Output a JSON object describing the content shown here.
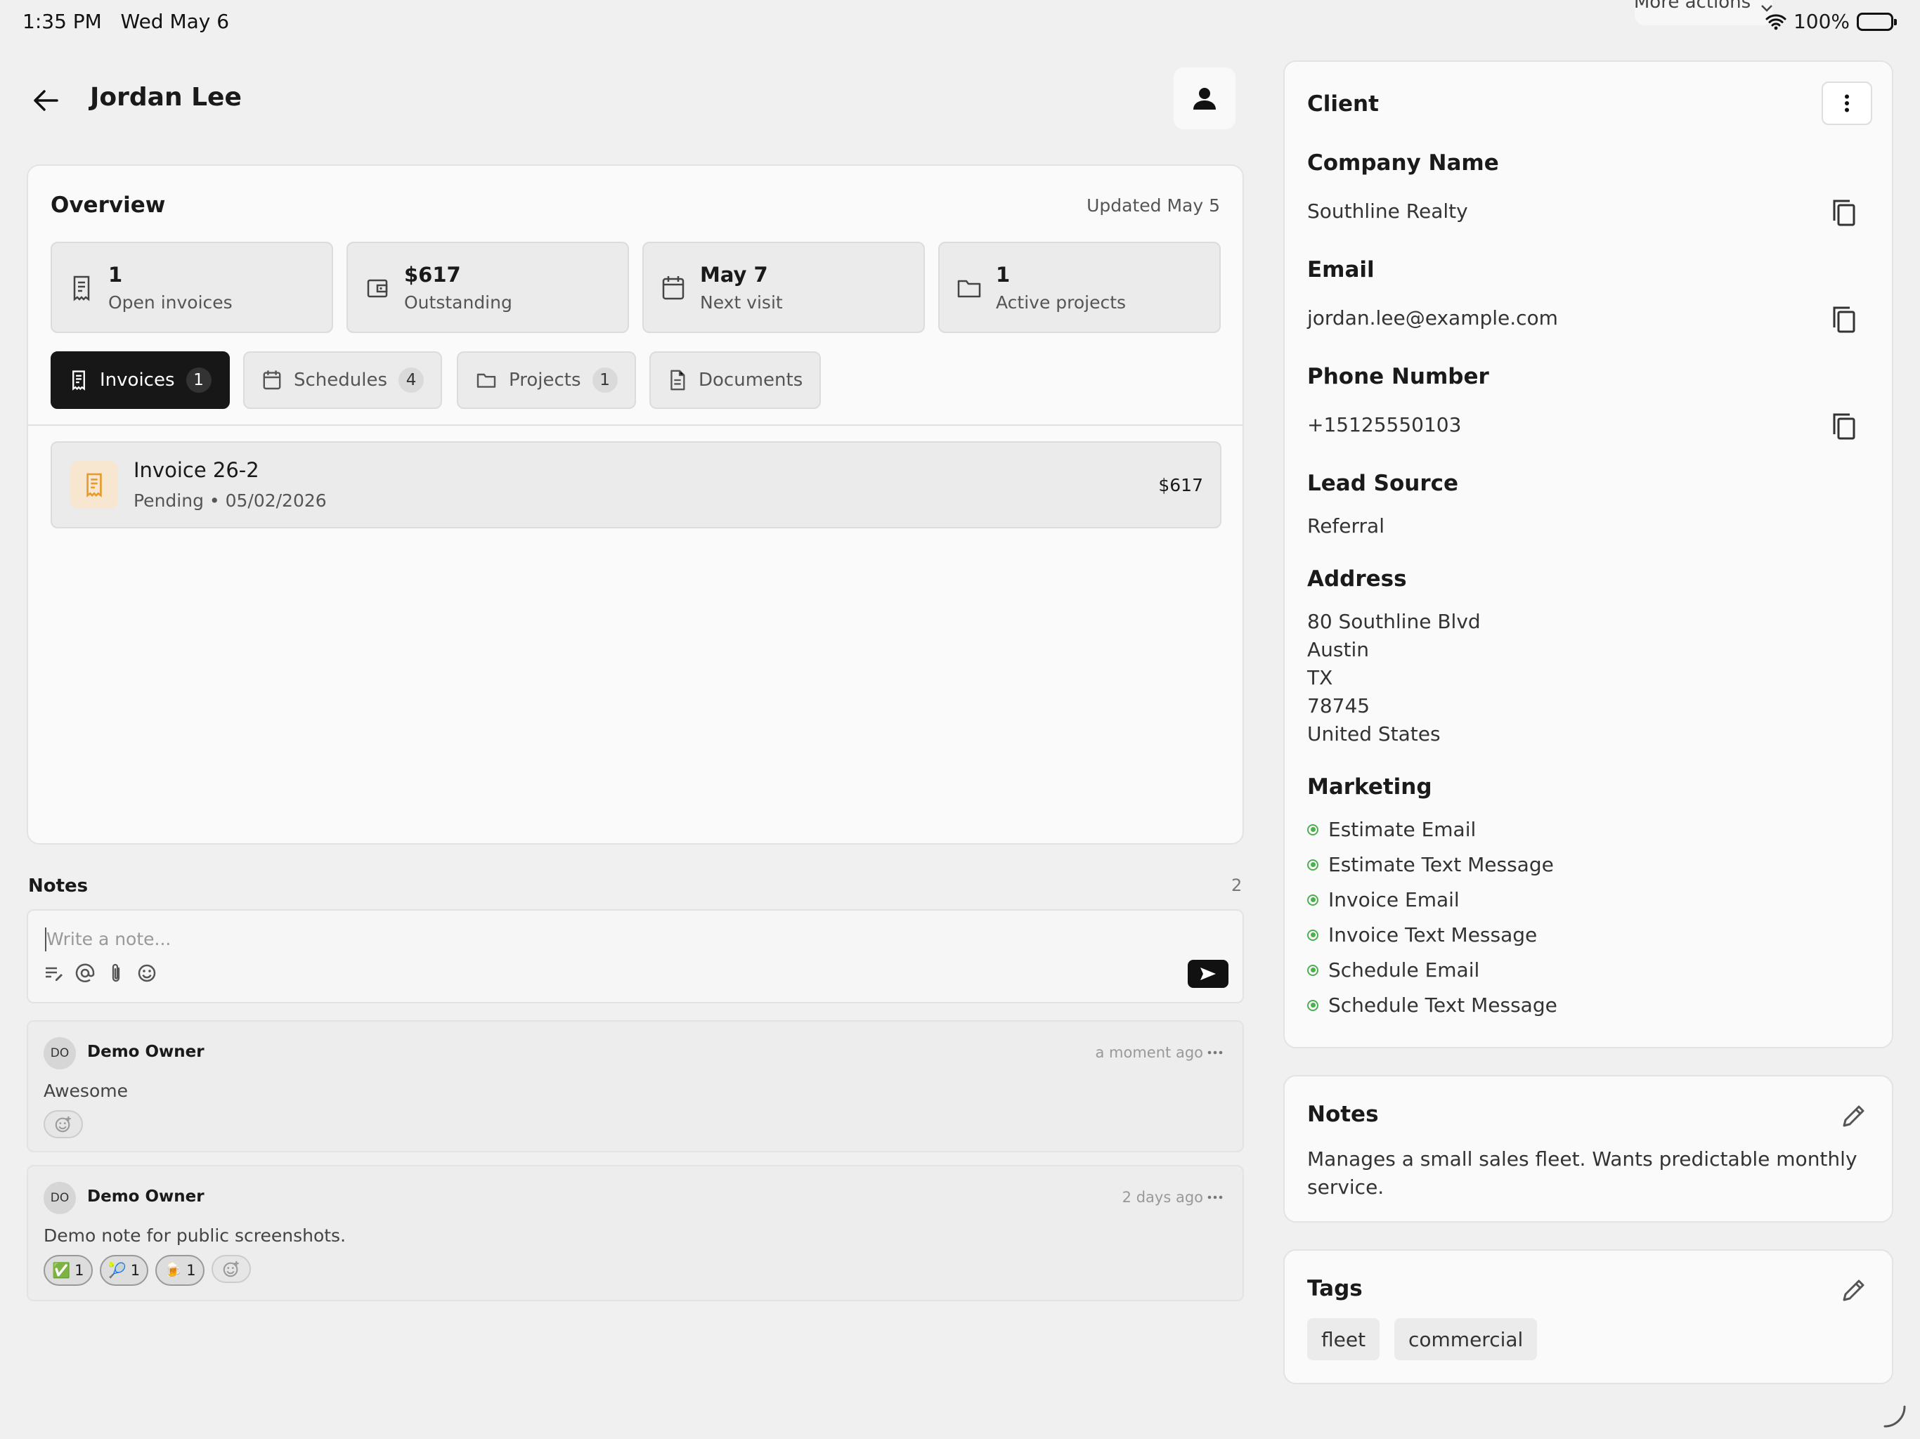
{
  "status_bar": {
    "time": "1:35 PM",
    "date": "Wed May 6",
    "battery": "100%"
  },
  "more_actions": {
    "label": "More actions"
  },
  "header": {
    "title": "Jordan Lee"
  },
  "overview": {
    "title": "Overview",
    "updated": "Updated May 5",
    "stats": [
      {
        "value": "1",
        "label": "Open invoices",
        "icon": "receipt-icon"
      },
      {
        "value": "$617",
        "label": "Outstanding",
        "icon": "wallet-icon"
      },
      {
        "value": "May 7",
        "label": "Next visit",
        "icon": "calendar-icon"
      },
      {
        "value": "1",
        "label": "Active projects",
        "icon": "folder-icon"
      }
    ],
    "tabs": [
      {
        "label": "Invoices",
        "count": "1",
        "active": true
      },
      {
        "label": "Schedules",
        "count": "4"
      },
      {
        "label": "Projects",
        "count": "1"
      },
      {
        "label": "Documents"
      }
    ],
    "invoices": [
      {
        "title": "Invoice 26-2",
        "subtitle": "Pending • 05/02/2026",
        "amount": "$617"
      }
    ]
  },
  "notes": {
    "title": "Notes",
    "count": "2",
    "placeholder": "Write a note...",
    "items": [
      {
        "initials": "DO",
        "author": "Demo Owner",
        "time": "a moment ago",
        "body": "Awesome",
        "reactions": []
      },
      {
        "initials": "DO",
        "author": "Demo Owner",
        "time": "2 days ago",
        "body": "Demo note for public screenshots.",
        "reactions": [
          {
            "emoji": "✅",
            "count": "1"
          },
          {
            "emoji": "🎾",
            "count": "1"
          },
          {
            "emoji": "🍺",
            "count": "1"
          }
        ]
      }
    ]
  },
  "client": {
    "title": "Client",
    "company_label": "Company Name",
    "company": "Southline Realty",
    "email_label": "Email",
    "email": "jordan.lee@example.com",
    "phone_label": "Phone Number",
    "phone": "+15125550103",
    "lead_label": "Lead Source",
    "lead": "Referral",
    "address_label": "Address",
    "address": [
      "80 Southline Blvd",
      "Austin",
      "TX",
      "78745",
      "United States"
    ],
    "marketing_label": "Marketing",
    "marketing": [
      "Estimate Email",
      "Estimate Text Message",
      "Invoice Email",
      "Invoice Text Message",
      "Schedule Email",
      "Schedule Text Message"
    ],
    "status_color": "#4caf50"
  },
  "client_notes": {
    "title": "Notes",
    "body": "Manages a small sales fleet. Wants predictable monthly service."
  },
  "tags": {
    "title": "Tags",
    "items": [
      "fleet",
      "commercial"
    ]
  }
}
